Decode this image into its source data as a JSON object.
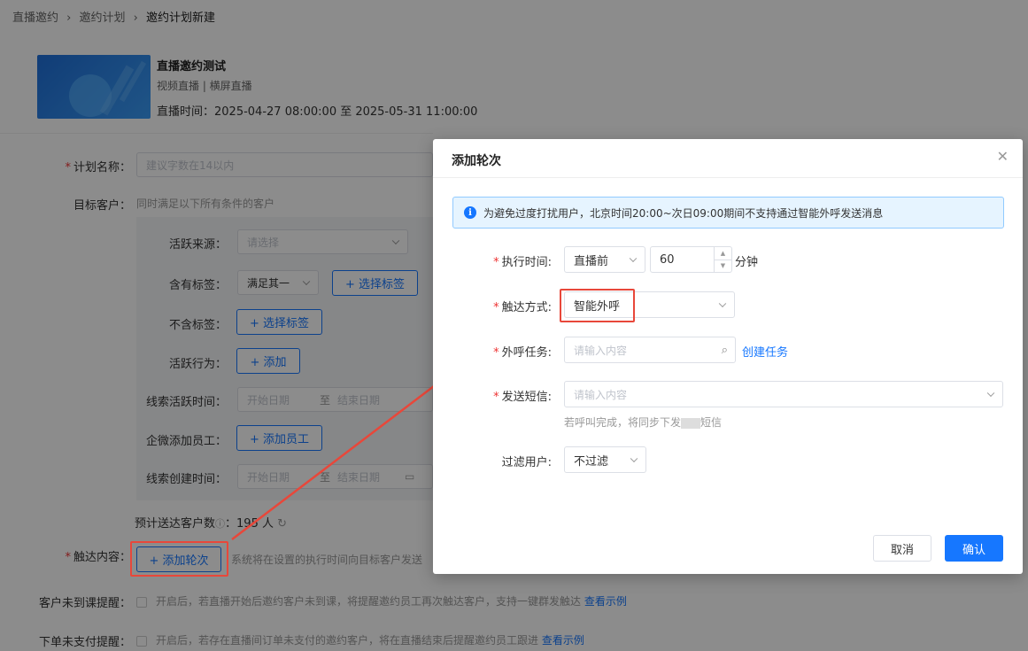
{
  "breadcrumb": [
    "直播邀约",
    "邀约计划",
    "邀约计划新建"
  ],
  "live": {
    "title": "直播邀约测试",
    "type": "视频直播 | 横屏直播",
    "time_label": "直播时间：",
    "time_value": "2025-04-27 08:00:00 至 2025-05-31 11:00:00"
  },
  "form": {
    "plan_name_label": "计划名称：",
    "plan_name_placeholder": "建议字数在14以内",
    "target_label": "目标客户：",
    "target_desc": "同时满足以下所有条件的客户",
    "active_source_label": "活跃来源：",
    "active_source_placeholder": "请选择",
    "has_tag_label": "含有标签：",
    "has_tag_select": "满足其一",
    "select_tag_btn": "+ 选择标签",
    "no_tag_label": "不含标签：",
    "no_tag_btn": "+ 选择标签",
    "active_behavior_label": "活跃行为：",
    "add_btn": "+ 添加",
    "lead_active_time_label": "线索活跃时间：",
    "start_date": "开始日期",
    "to": "至",
    "end_date": "结束日期",
    "wecom_staff_label": "企微添加员工：",
    "add_staff_btn": "+ 添加员工",
    "lead_create_time_label": "线索创建时间：",
    "estimated_label": "预计送达客户数",
    "estimated_value": "195 人",
    "reach_content_label": "触达内容：",
    "add_round_btn": "+ 添加轮次",
    "reach_content_desc": "系统将在设置的执行时间向目标客户发送",
    "absent_label": "客户未到课提醒：",
    "absent_desc": "开启后，若直播开始后邀约客户未到课，将提醒邀约员工再次触达客户，支持一键群发触达",
    "unpaid_label": "下单未支付提醒：",
    "unpaid_desc": "开启后，若存在直播间订单未支付的邀约客户，将在直播结束后提醒邀约员工跟进",
    "view_example": "查看示例"
  },
  "modal": {
    "title": "添加轮次",
    "notice": "为避免过度打扰用户，北京时间20:00~次日09:00期间不支持通过智能外呼发送消息",
    "exec_time_label": "执行时间:",
    "exec_time_select": "直播前",
    "exec_time_value": "60",
    "exec_time_unit": "分钟",
    "reach_method_label": "触达方式:",
    "reach_method_value": "智能外呼",
    "call_task_label": "外呼任务:",
    "call_task_placeholder": "请输入内容",
    "create_task_link": "创建任务",
    "sms_label": "发送短信:",
    "sms_placeholder": "请输入内容",
    "sms_hint_prefix": "若呼叫完成，将同步下发",
    "sms_hint_suffix": "短信",
    "filter_label": "过滤用户:",
    "filter_value": "不过滤",
    "cancel": "取消",
    "confirm": "确认"
  },
  "colors": {
    "primary": "#1677ff",
    "highlight_red": "#e8473a"
  }
}
